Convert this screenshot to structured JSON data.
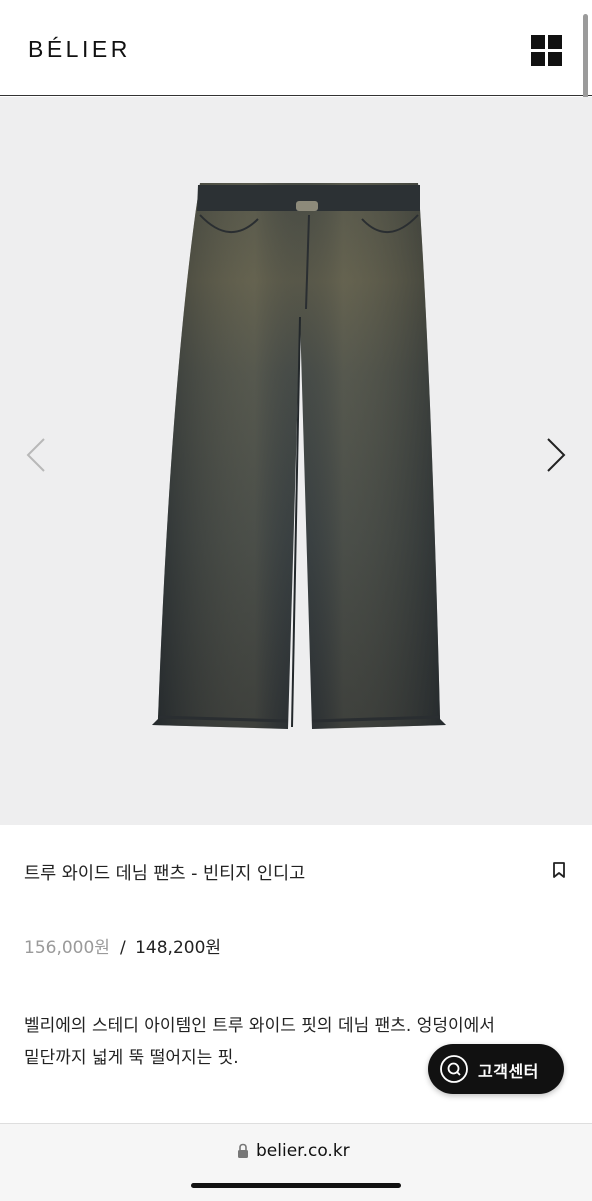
{
  "header": {
    "logo": "BÉLIER",
    "menu_icon": "grid-menu-icon"
  },
  "gallery": {
    "prev_icon": "chevron-left-icon",
    "next_icon": "chevron-right-icon",
    "image_icon": "wide-denim-pants-image",
    "background": "#eeeeef"
  },
  "product": {
    "title": "트루 와이드 데님 팬츠 - 빈티지 인디고",
    "bookmark_icon": "bookmark-icon",
    "original_price": "156,000원",
    "price_separator": "/",
    "sale_price": "148,200원",
    "description_lines": [
      "벨리에의 스테디 아이템인 트루 와이드 핏의 데님 팬츠. 엉덩이에서",
      "밑단까지 넓게 뚝 떨어지는 핏."
    ]
  },
  "support_button": {
    "label": "고객센터",
    "icon": "search-q-icon"
  },
  "browser": {
    "url": "belier.co.kr",
    "lock_icon": "lock-icon"
  },
  "colors": {
    "accent": "#111111",
    "price_original": "#9a9a9a",
    "hero_background": "#eeeeef"
  }
}
